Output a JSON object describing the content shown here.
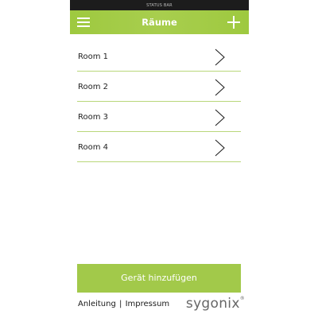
{
  "status_bar": {
    "label": "STATUS BAR"
  },
  "nav": {
    "title": "Räume"
  },
  "rooms": [
    {
      "label": "Room 1"
    },
    {
      "label": "Room 2"
    },
    {
      "label": "Room 3"
    },
    {
      "label": "Room 4"
    }
  ],
  "add_device_button": {
    "label": "Gerät hinzufügen"
  },
  "footer": {
    "manual_label": "Anleitung",
    "separator": "|",
    "imprint_label": "Impressum",
    "logo_text": "sygonix",
    "logo_mark": "®"
  },
  "colors": {
    "accent": "#a3cb45",
    "divider": "#b9d77a",
    "status_bar": "#1c1c1c"
  },
  "icons": {
    "menu": "hamburger-menu-icon",
    "add": "plus-icon",
    "row_arrow": "chevron-right-icon"
  }
}
